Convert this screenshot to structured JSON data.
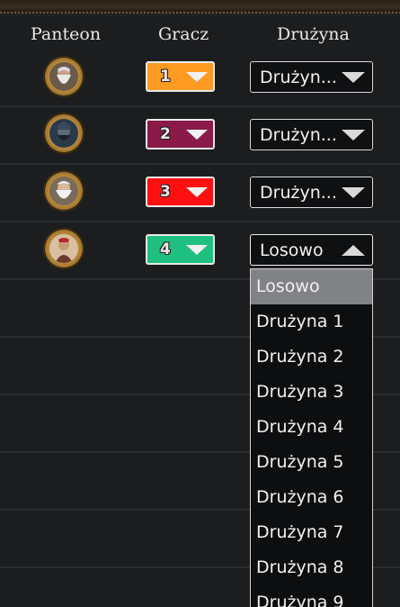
{
  "headers": {
    "pantheon": "Panteon",
    "player": "Gracz",
    "team": "Drużyna"
  },
  "rows": [
    {
      "avatar": "bearded-elder-portrait-icon",
      "player_number": "1",
      "player_color": "#ff9a22",
      "team_value": "Drużyn..."
    },
    {
      "avatar": "dark-warrior-portrait-icon",
      "player_number": "2",
      "player_color": "#8a1a48",
      "team_value": "Drużyn..."
    },
    {
      "avatar": "white-bearded-god-portrait-icon",
      "player_number": "3",
      "player_color": "#ff1010",
      "team_value": "Drużyn..."
    },
    {
      "avatar": "robed-figure-portrait-icon",
      "player_number": "4",
      "player_color": "#1fbf7f",
      "team_value": "Losowo"
    }
  ],
  "team_dropdown": {
    "selected": "Losowo",
    "options": [
      "Losowo",
      "Drużyna 1",
      "Drużyna 2",
      "Drużyna 3",
      "Drużyna 4",
      "Drużyna 5",
      "Drużyna 6",
      "Drużyna 7",
      "Drużyna 8",
      "Drużyna 9"
    ]
  }
}
